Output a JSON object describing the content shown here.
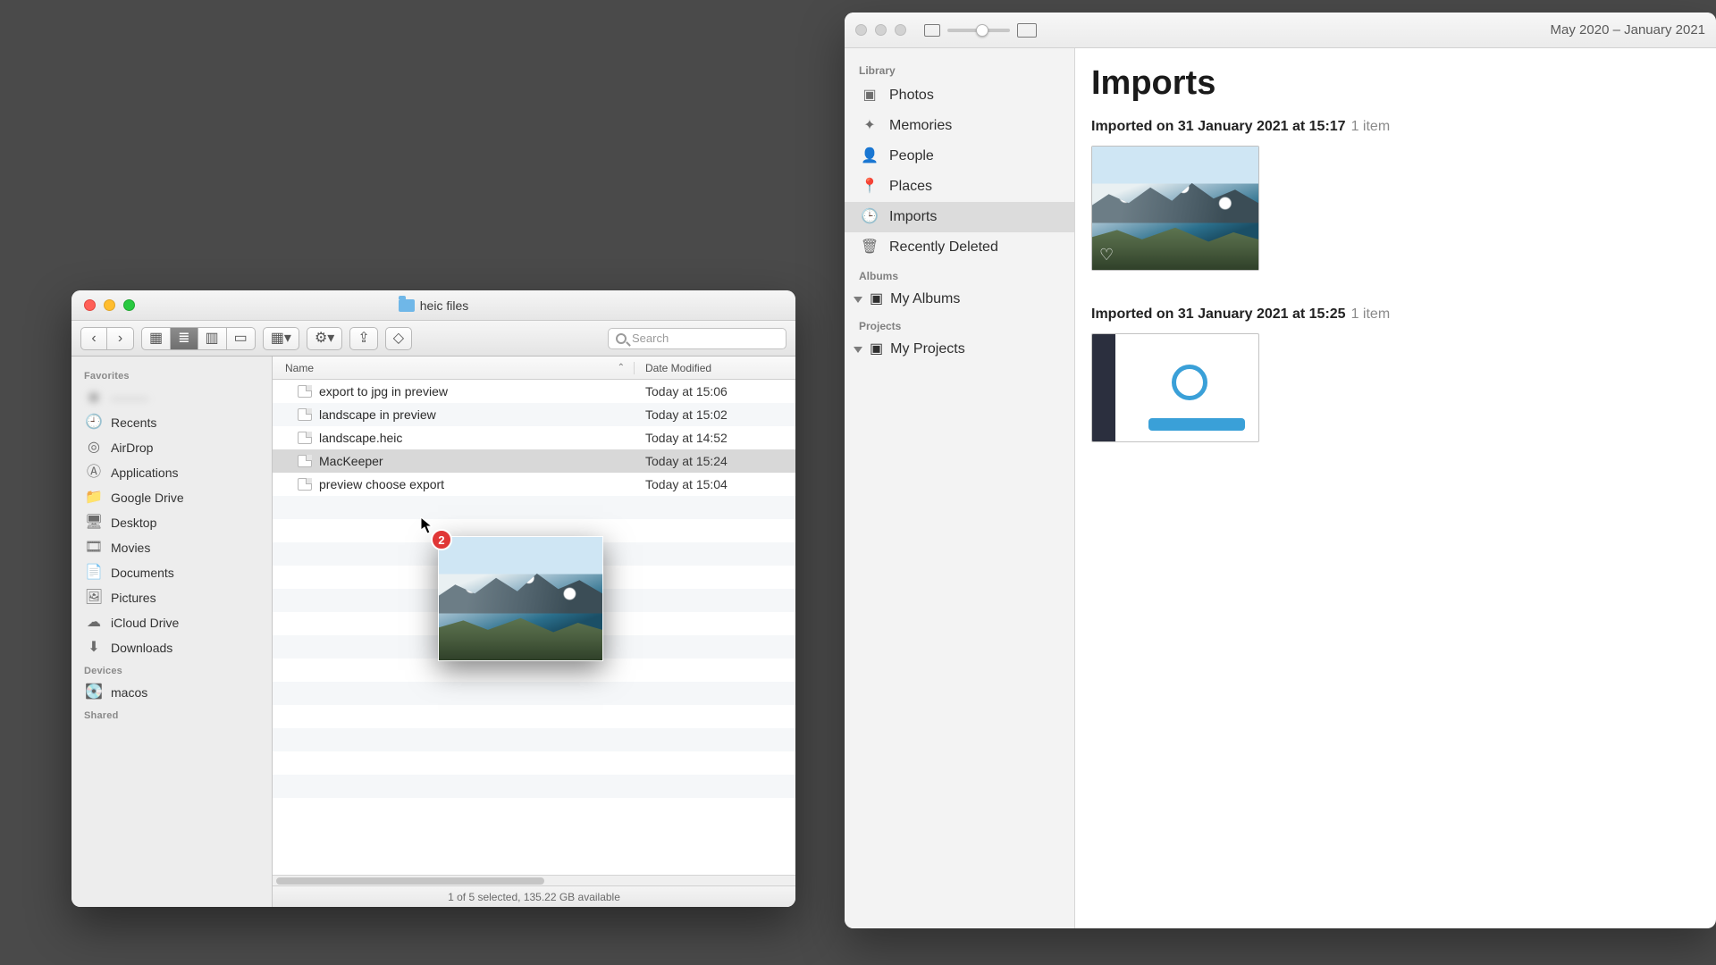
{
  "finder": {
    "title": "heic files",
    "search_placeholder": "Search",
    "sidebar": {
      "sections": [
        {
          "header": "Favorites",
          "items": [
            {
              "label": "———",
              "icon": "person-icon",
              "blurred": true
            },
            {
              "label": "Recents",
              "icon": "recents-icon"
            },
            {
              "label": "AirDrop",
              "icon": "airdrop-icon"
            },
            {
              "label": "Applications",
              "icon": "applications-icon"
            },
            {
              "label": "Google Drive",
              "icon": "folder-icon"
            },
            {
              "label": "Desktop",
              "icon": "desktop-icon"
            },
            {
              "label": "Movies",
              "icon": "movies-icon"
            },
            {
              "label": "Documents",
              "icon": "documents-icon"
            },
            {
              "label": "Pictures",
              "icon": "pictures-icon"
            },
            {
              "label": "iCloud Drive",
              "icon": "cloud-icon"
            },
            {
              "label": "Downloads",
              "icon": "downloads-icon"
            }
          ]
        },
        {
          "header": "Devices",
          "items": [
            {
              "label": "macos",
              "icon": "disk-icon"
            }
          ]
        },
        {
          "header": "Shared",
          "items": []
        }
      ]
    },
    "columns": {
      "name": "Name",
      "date": "Date Modified"
    },
    "rows": [
      {
        "name": "export to jpg in preview",
        "date": "Today at 15:06"
      },
      {
        "name": "landscape in preview",
        "date": "Today at 15:02"
      },
      {
        "name": "landscape.heic",
        "date": "Today at 14:52"
      },
      {
        "name": "MacKeeper",
        "date": "Today at 15:24",
        "selected": true
      },
      {
        "name": "preview choose export",
        "date": "Today at 15:04"
      }
    ],
    "drag_badge": "2",
    "status": "1 of 5 selected, 135.22 GB available"
  },
  "photos": {
    "date_range": "May 2020 – January 2021",
    "sidebar": {
      "library_header": "Library",
      "library_items": [
        {
          "label": "Photos",
          "icon": "photos-icon"
        },
        {
          "label": "Memories",
          "icon": "memories-icon"
        },
        {
          "label": "People",
          "icon": "people-icon"
        },
        {
          "label": "Places",
          "icon": "places-icon"
        },
        {
          "label": "Imports",
          "icon": "imports-icon",
          "selected": true
        },
        {
          "label": "Recently Deleted",
          "icon": "trash-icon"
        }
      ],
      "albums_header": "Albums",
      "my_albums": "My Albums",
      "projects_header": "Projects",
      "my_projects": "My Projects"
    },
    "main": {
      "title": "Imports",
      "groups": [
        {
          "line": "Imported on 31 January 2021 at 15:17",
          "count": "1 item",
          "thumb": "landscape"
        },
        {
          "line": "Imported on 31 January 2021 at 15:25",
          "count": "1 item",
          "thumb": "app"
        }
      ]
    }
  }
}
